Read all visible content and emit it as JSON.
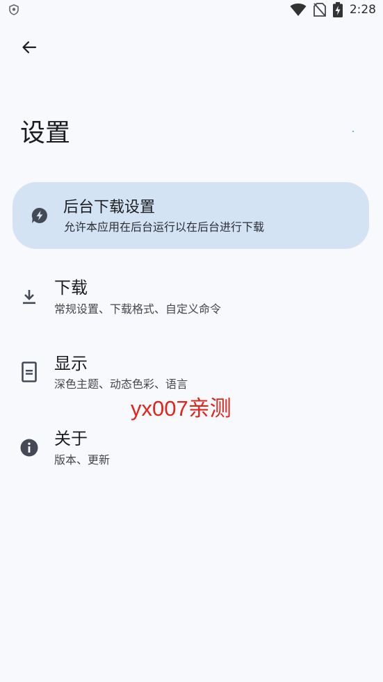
{
  "status_bar": {
    "time": "2:28",
    "icons": [
      "shield-icon",
      "wifi-icon",
      "no-sim-icon",
      "battery-charging-icon"
    ]
  },
  "header": {
    "back_icon": "arrow-left-icon",
    "title": "设置"
  },
  "background_card": {
    "icon": "bolt-chat-icon",
    "title": "后台下载设置",
    "subtitle": "允许本应用在后台运行以在后台进行下载",
    "color": "#D4E3F4"
  },
  "settings": [
    {
      "icon": "download-icon",
      "title": "下载",
      "subtitle": "常规设置、下载格式、自定义命令"
    },
    {
      "icon": "display-icon",
      "title": "显示",
      "subtitle": "深色主题、动态色彩、语言"
    },
    {
      "icon": "info-icon",
      "title": "关于",
      "subtitle": "版本、更新"
    }
  ],
  "watermark": "yx007亲测",
  "colors": {
    "background": "#F8F9FD",
    "icon": "#434A55",
    "watermark": "#E2231A"
  }
}
